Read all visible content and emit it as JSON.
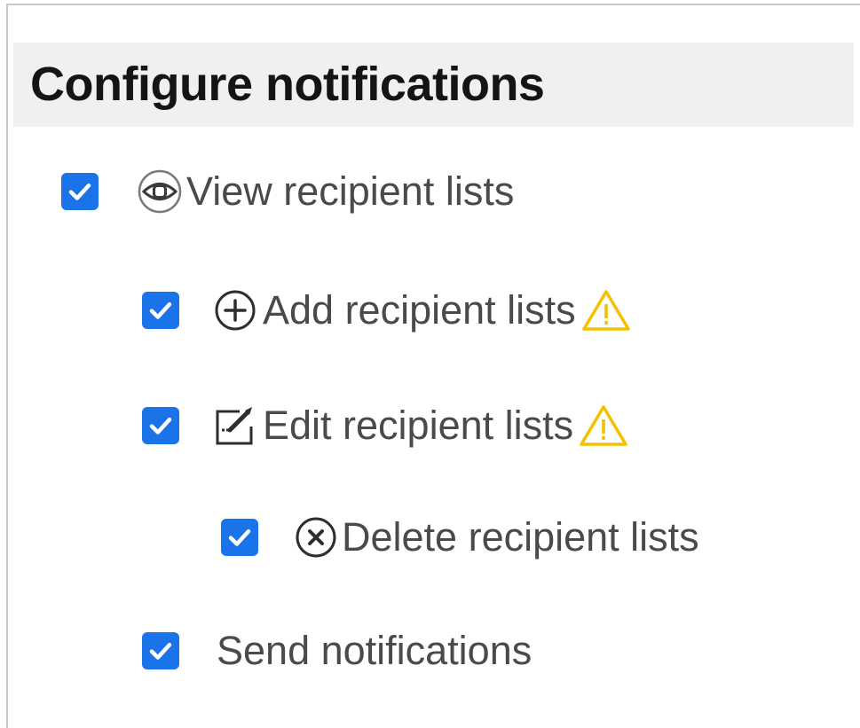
{
  "title": "Configure notifications",
  "permissions": [
    {
      "label": "View recipient lists",
      "checked": true,
      "icon": "eye-icon",
      "warning": false
    },
    {
      "label": "Add recipient lists",
      "checked": true,
      "icon": "plus-circle-icon",
      "warning": true
    },
    {
      "label": "Edit recipient lists",
      "checked": true,
      "icon": "edit-icon",
      "warning": true
    },
    {
      "label": "Delete recipient lists",
      "checked": true,
      "icon": "x-circle-icon",
      "warning": false
    },
    {
      "label": "Send notifications",
      "checked": true,
      "icon": null,
      "warning": false
    }
  ],
  "colors": {
    "checkbox": "#1a73e8",
    "warning": "#f5c000",
    "header_bg": "#f0f0f0"
  }
}
